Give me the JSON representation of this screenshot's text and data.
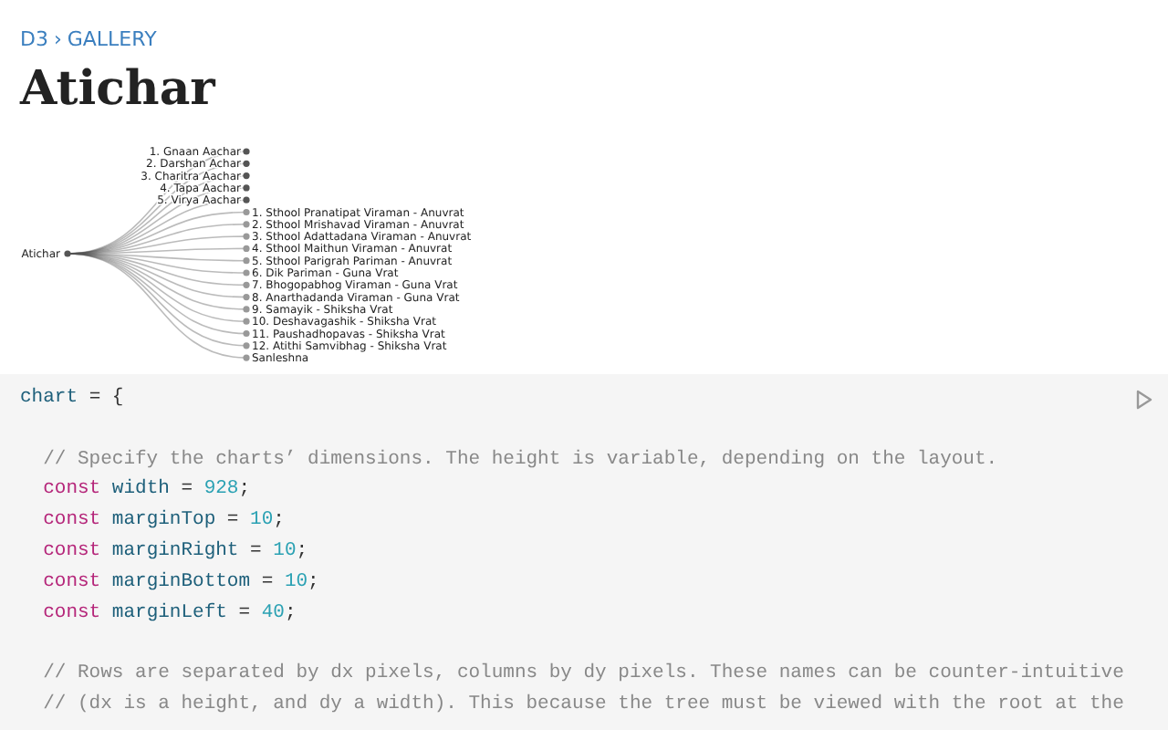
{
  "breadcrumb": {
    "parent": "D3",
    "section": "GALLERY",
    "separator": "›"
  },
  "title": "Atichar",
  "tree": {
    "label": "Atichar",
    "children": [
      {
        "label": "1. Gnaan Aachar",
        "kind": "internal"
      },
      {
        "label": "2. Darshan Achar",
        "kind": "internal"
      },
      {
        "label": "3. Charitra Aachar",
        "kind": "internal"
      },
      {
        "label": "4. Tapa Aachar",
        "kind": "internal"
      },
      {
        "label": "5. Virya Aachar",
        "kind": "internal"
      },
      {
        "label": "1. Sthool Pranatipat Viraman - Anuvrat",
        "kind": "leaf"
      },
      {
        "label": "2. Sthool Mrishavad Viraman - Anuvrat",
        "kind": "leaf"
      },
      {
        "label": "3. Sthool Adattadana Viraman - Anuvrat",
        "kind": "leaf"
      },
      {
        "label": "4. Sthool Maithun Viraman - Anuvrat",
        "kind": "leaf"
      },
      {
        "label": "5. Sthool Parigrah Pariman - Anuvrat",
        "kind": "leaf"
      },
      {
        "label": "6. Dik Pariman - Guna Vrat",
        "kind": "leaf"
      },
      {
        "label": "7. Bhogopabhog Viraman - Guna Vrat",
        "kind": "leaf"
      },
      {
        "label": "8. Anarthadanda Viraman - Guna Vrat",
        "kind": "leaf"
      },
      {
        "label": "9. Samayik - Shiksha Vrat",
        "kind": "leaf"
      },
      {
        "label": "10. Deshavagashik - Shiksha Vrat",
        "kind": "leaf"
      },
      {
        "label": "11. Paushadhopavas - Shiksha Vrat",
        "kind": "leaf"
      },
      {
        "label": "12. Atithi Samvibhag - Shiksha Vrat",
        "kind": "leaf"
      },
      {
        "label": "Sanleshna",
        "kind": "leaf"
      }
    ]
  },
  "code": {
    "lines": [
      [
        {
          "kind": "name",
          "text": "chart"
        },
        {
          "kind": "plain",
          "text": " = {"
        }
      ],
      [
        {
          "kind": "gap"
        },
        {
          "kind": "comment",
          "text": "  // Specify the charts’ dimensions. The height is variable, depending on the layout."
        }
      ],
      [
        {
          "kind": "keyword",
          "text": "  const"
        },
        {
          "kind": "name",
          "text": " width"
        },
        {
          "kind": "plain",
          "text": " = "
        },
        {
          "kind": "number",
          "text": "928"
        },
        {
          "kind": "plain",
          "text": ";"
        }
      ],
      [
        {
          "kind": "keyword",
          "text": "  const"
        },
        {
          "kind": "name",
          "text": " marginTop"
        },
        {
          "kind": "plain",
          "text": " = "
        },
        {
          "kind": "number",
          "text": "10"
        },
        {
          "kind": "plain",
          "text": ";"
        }
      ],
      [
        {
          "kind": "keyword",
          "text": "  const"
        },
        {
          "kind": "name",
          "text": " marginRight"
        },
        {
          "kind": "plain",
          "text": " = "
        },
        {
          "kind": "number",
          "text": "10"
        },
        {
          "kind": "plain",
          "text": ";"
        }
      ],
      [
        {
          "kind": "keyword",
          "text": "  const"
        },
        {
          "kind": "name",
          "text": " marginBottom"
        },
        {
          "kind": "plain",
          "text": " = "
        },
        {
          "kind": "number",
          "text": "10"
        },
        {
          "kind": "plain",
          "text": ";"
        }
      ],
      [
        {
          "kind": "keyword",
          "text": "  const"
        },
        {
          "kind": "name",
          "text": " marginLeft"
        },
        {
          "kind": "plain",
          "text": " = "
        },
        {
          "kind": "number",
          "text": "40"
        },
        {
          "kind": "plain",
          "text": ";"
        }
      ],
      [
        {
          "kind": "gap"
        },
        {
          "kind": "comment",
          "text": "  // Rows are separated by dx pixels, columns by dy pixels. These names can be counter-intuitive"
        }
      ],
      [
        {
          "kind": "comment",
          "text": "  // (dx is a height, and dy a width). This because the tree must be viewed with the root at the"
        }
      ]
    ]
  }
}
